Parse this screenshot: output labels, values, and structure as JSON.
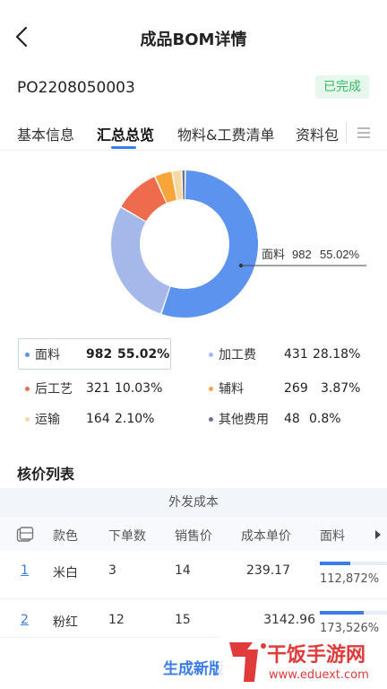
{
  "header": {
    "title": "成品BOM详情",
    "back_icon": "chevron-left-icon"
  },
  "order": {
    "number": "PO2208050003",
    "status": "已完成"
  },
  "tabs": [
    {
      "label": "基本信息",
      "active": false
    },
    {
      "label": "汇总总览",
      "active": true
    },
    {
      "label": "物料&工费清单",
      "active": false
    },
    {
      "label": "资料包",
      "active": false
    }
  ],
  "colors": {
    "accent": "#3b7de8",
    "status_green": "#37b865"
  },
  "chart_data": {
    "type": "pie",
    "donut": true,
    "callout": {
      "label": "面料",
      "value": "982",
      "percent": "55.02%"
    },
    "slices": [
      {
        "name": "面料",
        "value": 982,
        "percent": 55.02,
        "color": "#5b93ee"
      },
      {
        "name": "加工费",
        "value": 431,
        "percent": 28.18,
        "color": "#a4b8e9"
      },
      {
        "name": "后工艺",
        "value": 321,
        "percent": 10.03,
        "color": "#ee6b4d"
      },
      {
        "name": "辅料",
        "value": 269,
        "percent": 3.87,
        "color": "#f7a53b"
      },
      {
        "name": "运输",
        "value": 164,
        "percent": 2.1,
        "color": "#f6d9a3"
      },
      {
        "name": "其他费用",
        "value": 48,
        "percent": 0.8,
        "color": "#6b7585"
      }
    ]
  },
  "legend": [
    {
      "name": "面料",
      "value": "982",
      "percent": "55.02%",
      "color": "#5b93ee",
      "selected": true
    },
    {
      "name": "加工费",
      "value": "431",
      "percent": "28.18%",
      "color": "#a4b8e9",
      "selected": false
    },
    {
      "name": "后工艺",
      "value": "321",
      "percent": "10.03%",
      "color": "#ee6b4d",
      "selected": false
    },
    {
      "name": "辅料",
      "value": "269",
      "percent": "3.87%",
      "color": "#f7a53b",
      "selected": false
    },
    {
      "name": "运输",
      "value": "164",
      "percent": "2.10%",
      "color": "#f6d9a3",
      "selected": false
    },
    {
      "name": "其他费用",
      "value": "48",
      "percent": "0.8%",
      "color": "#6b7585",
      "selected": false
    }
  ],
  "price_list": {
    "title": "核价列表",
    "group_header": "外发成本",
    "columns": [
      "款色",
      "下单数",
      "销售价",
      "成本单价",
      "面料"
    ],
    "rows": [
      {
        "index": "1",
        "color": "米白",
        "qty": "3",
        "sale_price": "14",
        "unit_cost": "239.17",
        "fabric_pct": "112,872%",
        "fabric_bar_fraction": 0.45
      },
      {
        "index": "2",
        "color": "粉红",
        "qty": "12",
        "sale_price": "15",
        "unit_cost": "3142.96",
        "fabric_pct": "173,526%",
        "fabric_bar_fraction": 0.65
      }
    ]
  },
  "footer": {
    "generate_label": "生成新版"
  },
  "watermark": {
    "text": "干饭手游网",
    "url": "www.eduext.com"
  }
}
